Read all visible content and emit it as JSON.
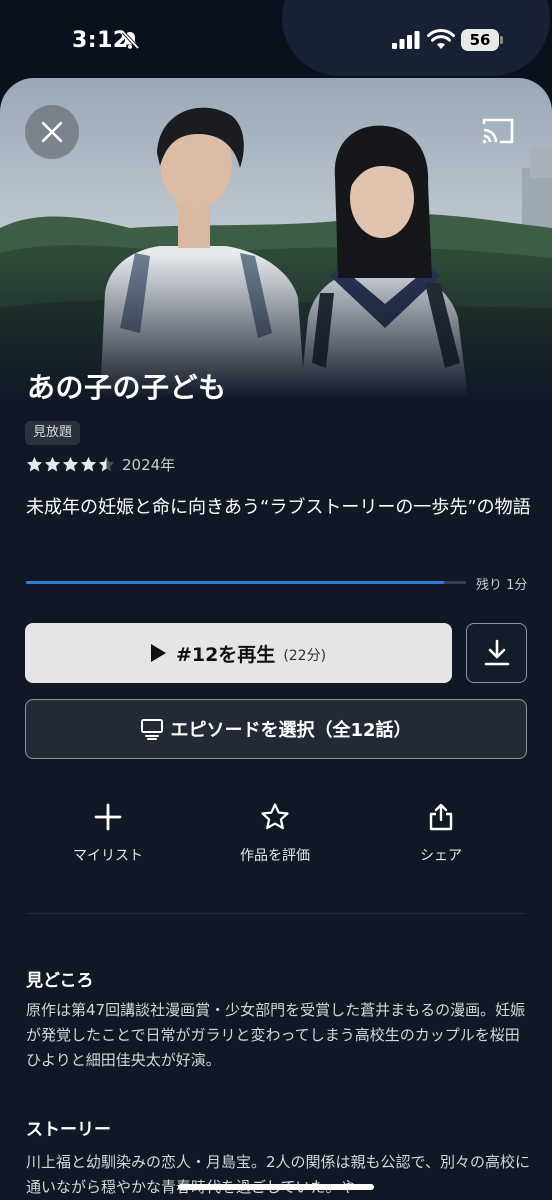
{
  "status_bar": {
    "time": "3:12",
    "battery": "56",
    "icons": [
      "bell-slash-icon",
      "cellular-signal-icon",
      "wifi-icon",
      "battery-icon"
    ]
  },
  "hero": {
    "image_description": "still image",
    "close_icon": "close-icon",
    "cast_icon": "cast-icon"
  },
  "title": {
    "name": "あの子の子ども",
    "badge": "見放題",
    "rating": 4.5,
    "rating_max": 5,
    "year": "2024年"
  },
  "synopsis_short": "未成年の妊娠と命に向きあう“ラブストーリーの一歩先”の物語",
  "progress": {
    "fraction": 0.95,
    "remaining_label": "残り 1分"
  },
  "buttons": {
    "play_label": "#12を再生",
    "play_duration": "(22分)",
    "download_icon": "download-icon",
    "episode_label": "エピソードを選択（全12話）",
    "episode_icon": "episode-list-icon"
  },
  "actions": {
    "mylist": {
      "label": "マイリスト",
      "icon": "plus-icon"
    },
    "rate": {
      "label": "作品を評価",
      "icon": "star-outline-icon"
    },
    "share": {
      "label": "シェア",
      "icon": "share-icon"
    }
  },
  "highlights": {
    "heading": "見どころ",
    "body": "原作は第47回講談社漫画賞・少女部門を受賞した蒼井まもるの漫画。妊娠が発覚したことで日常がガラリと変わってしまう高校生のカップルを桜田ひよりと細田佳央太が好演。"
  },
  "story": {
    "heading": "ストーリー",
    "body": "川上福と幼馴染みの恋人・月島宝。2人の関係は親も公認で、別々の高校に通いながら穏やかな青春時代を過ごしていた。や"
  },
  "colors": {
    "background": "#101826",
    "progress": "#2b7fe0",
    "play_button": "#e5e5e8"
  }
}
